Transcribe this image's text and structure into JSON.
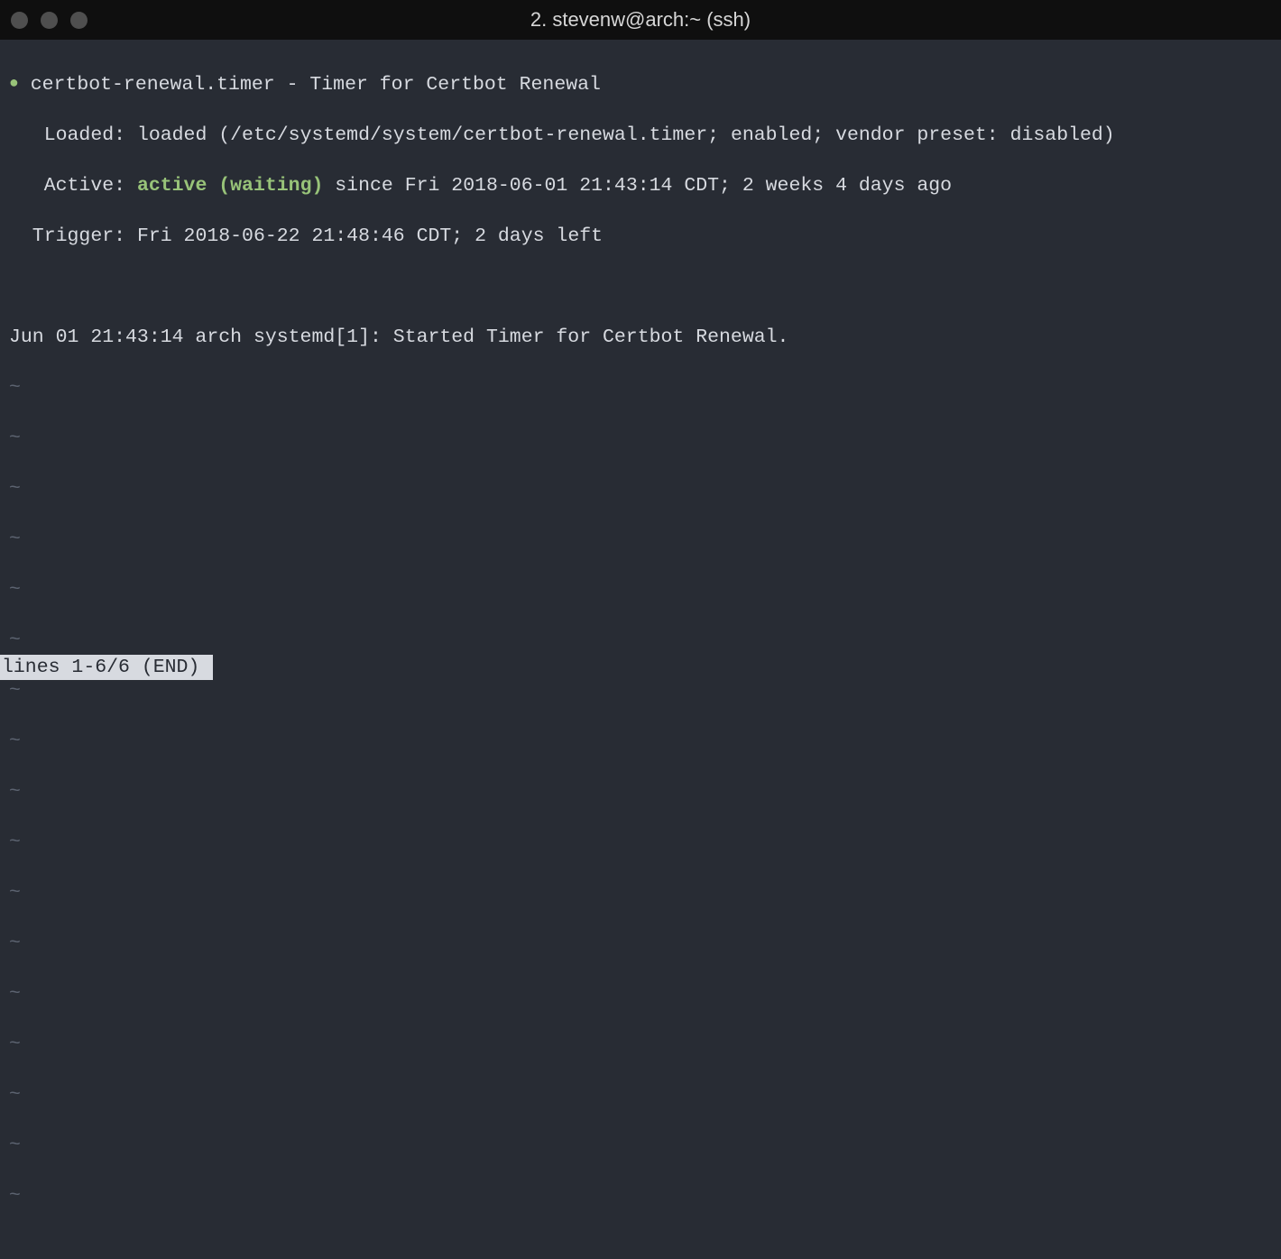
{
  "window": {
    "title": "2. stevenw@arch:~ (ssh)"
  },
  "status": {
    "unit_name": "certbot-renewal.timer - Timer for Certbot Renewal",
    "loaded_label": "   Loaded: ",
    "loaded_value": "loaded (/etc/systemd/system/certbot-renewal.timer; enabled; vendor preset: disabled)",
    "active_label": "   Active: ",
    "active_state": "active (waiting)",
    "active_since": " since Fri 2018-06-01 21:43:14 CDT; 2 weeks 4 days ago",
    "trigger_label": "  Trigger: ",
    "trigger_value": "Fri 2018-06-22 21:48:46 CDT; 2 days left"
  },
  "log": {
    "line1": "Jun 01 21:43:14 arch systemd[1]: Started Timer for Certbot Renewal."
  },
  "pager": {
    "tilde": "~",
    "status": "lines 1-6/6 (END)"
  }
}
